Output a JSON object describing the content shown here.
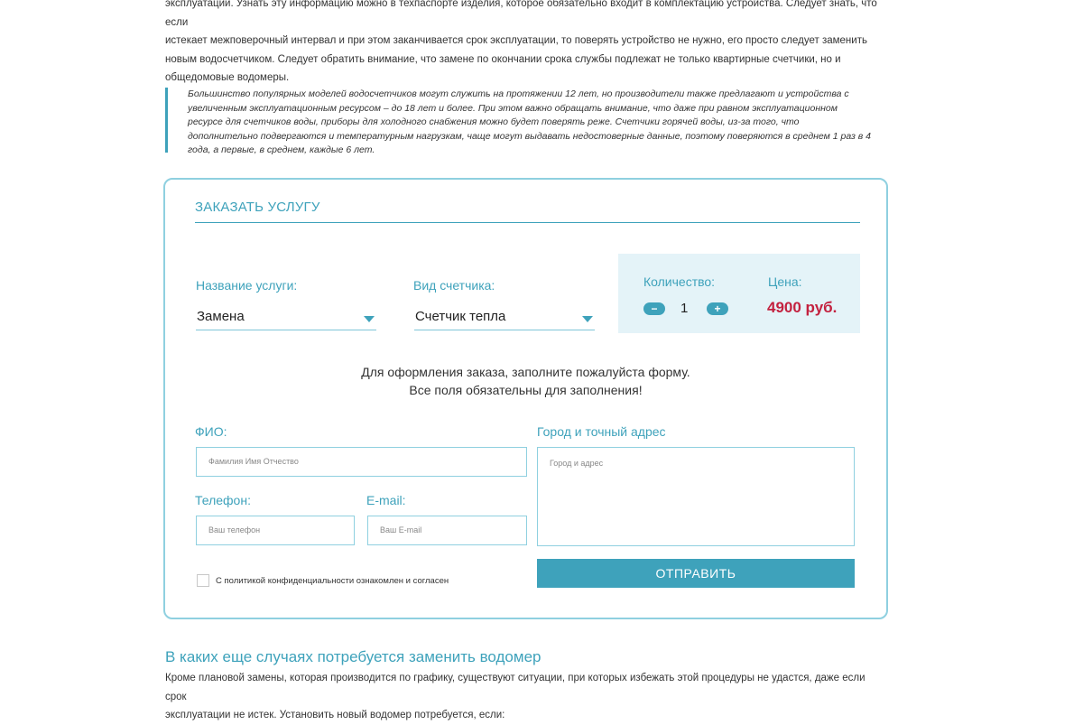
{
  "article": {
    "intro_lines": [
      "эксплуатации. Узнать эту информацию можно в техпаспорте изделия, которое обязательно входит в комплектацию устройства. Следует знать, что если",
      "истекает межповерочный интервал и при этом заканчивается срок эксплуатации, то поверять устройство не нужно, его просто следует заменить",
      "новым водосчетчиком. Следует обратить внимание, что замене по окончании срока службы подлежат не только квартирные счетчики, но и",
      "общедомовые водомеры."
    ],
    "quote_lines": [
      "Большинство популярных моделей водосчетчиков могут служить на протяжении 12 лет, но производители также предлагают и устройства с",
      "увеличенным эксплуатационным ресурсом – до 18 лет и более. При этом важно обращать внимание, что даже при равном эксплуатационном",
      "ресурсе для счетчиков воды, приборы для холодного снабжения можно будет поверять реже. Счетчики горячей воды, из-за того, что",
      "дополнительно подвергаются и температурным нагрузкам, чаще могут выдавать недостоверные данные, поэтому поверяются в среднем 1 раз в 4",
      "года, а первые, в среднем, каждые 6 лет."
    ],
    "section_title": "В каких еще случаях потребуется заменить водомер",
    "outro_lines": [
      "Кроме плановой замены, которая производится по графику, существуют ситуации, при которых избежать этой процедуры не удастся, даже если срок",
      "эксплуатации не истек. Установить новый водомер потребуется, если:"
    ]
  },
  "order_form": {
    "title": "ЗАКАЗАТЬ УСЛУГУ",
    "service_label": "Название услуги:",
    "service_value": "Замена",
    "meter_label": "Вид счетчика:",
    "meter_value": "Счетчик тепла",
    "quantity_label": "Количество:",
    "quantity_value": "1",
    "minus": "−",
    "plus": "+",
    "price_label": "Цена:",
    "price_value": "4900 руб.",
    "notice_line1": "Для оформления заказа, заполните пожалуйста форму.",
    "notice_line2": "Все поля обязательны для заполнения!",
    "fio_label": "ФИО:",
    "fio_placeholder": "Фамилия Имя Отчество",
    "phone_label": "Телефон:",
    "phone_placeholder": "Ваш телефон",
    "email_label": "E-mail:",
    "email_placeholder": "Ваш E-mail",
    "address_label": "Город и точный адрес",
    "address_placeholder": "Город и адрес",
    "consent_label": "С политикой конфиденциальности ознакомлен и согласен",
    "submit_label": "ОТПРАВИТЬ"
  },
  "colors": {
    "accent": "#3ea2bb",
    "price": "#c3213f",
    "qty_panel": "#e4f3f8"
  }
}
